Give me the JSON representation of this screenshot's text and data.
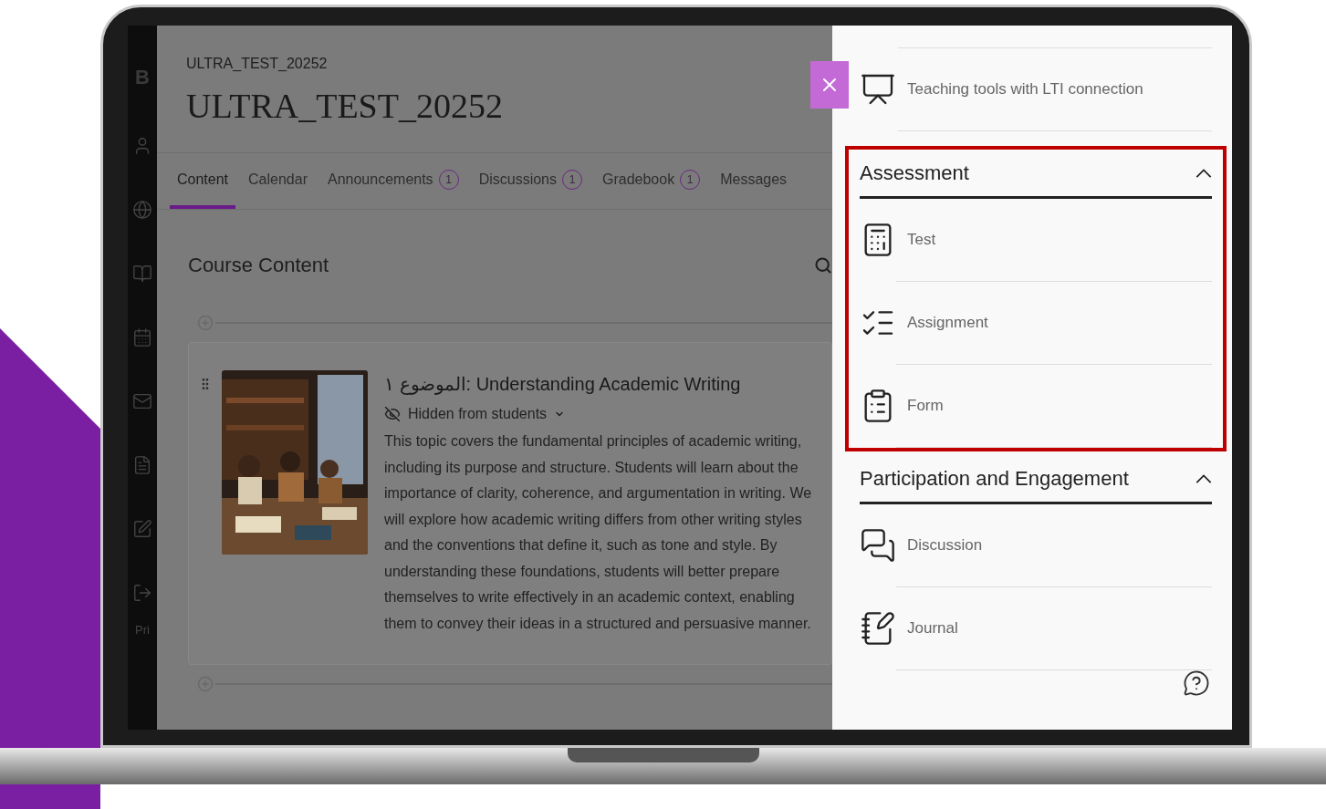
{
  "sidebar": {
    "logo": "B",
    "footer": "Pri"
  },
  "course": {
    "code": "ULTRA_TEST_20252",
    "title": "ULTRA_TEST_20252"
  },
  "tabs": [
    {
      "label": "Content",
      "selected": true
    },
    {
      "label": "Calendar",
      "selected": false
    },
    {
      "label": "Announcements",
      "badge": "1",
      "selected": false
    },
    {
      "label": "Discussions",
      "badge": "1",
      "selected": false
    },
    {
      "label": "Gradebook",
      "badge": "1",
      "selected": false
    },
    {
      "label": "Messages",
      "selected": false
    }
  ],
  "course_content": {
    "heading": "Course Content",
    "items": [
      {
        "title": "الموضوع ١: Understanding Academic Writing",
        "visibility": "Hidden from students",
        "description": "This topic covers the fundamental principles of academic writing, including its purpose and structure. Students will learn about the importance of clarity, coherence, and argumentation in writing. We will explore how academic writing differs from other writing styles and the conventions that define it, such as tone and style. By understanding these foundations, students will better prepare themselves to write effectively in an academic context, enabling them to convey their ideas in a structured and persuasive manner."
      }
    ]
  },
  "panel": {
    "items": [
      {
        "label": "Teaching tools with LTI connection",
        "kind": "lti"
      }
    ],
    "sections": [
      {
        "title": "Assessment",
        "expanded": true,
        "highlighted": true,
        "items": [
          {
            "label": "Test",
            "kind": "test"
          },
          {
            "label": "Assignment",
            "kind": "assignment"
          },
          {
            "label": "Form",
            "kind": "form"
          }
        ]
      },
      {
        "title": "Participation and Engagement",
        "expanded": true,
        "highlighted": false,
        "items": [
          {
            "label": "Discussion",
            "kind": "discussion"
          },
          {
            "label": "Journal",
            "kind": "journal"
          }
        ]
      }
    ]
  }
}
